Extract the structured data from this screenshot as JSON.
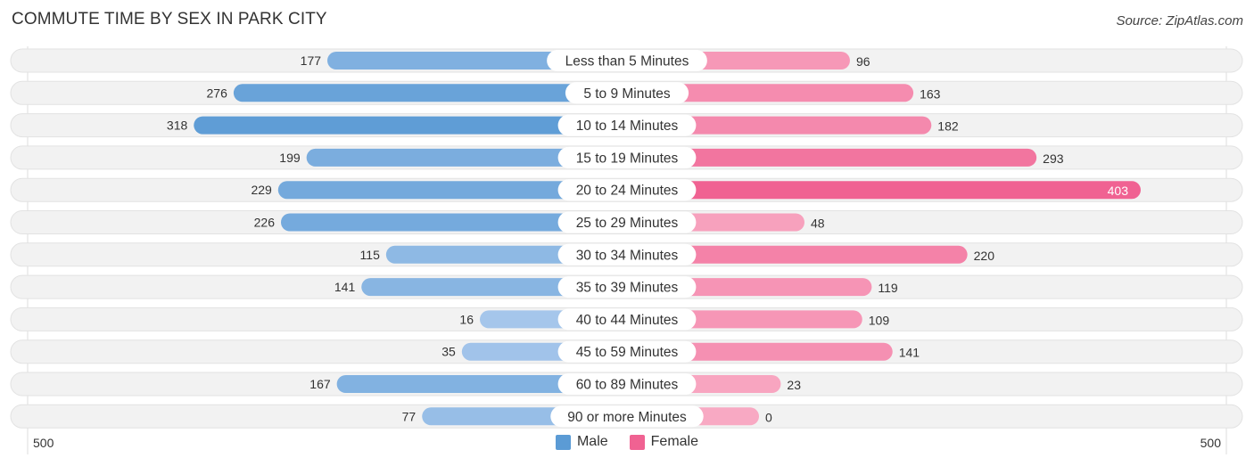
{
  "header": {
    "title": "COMMUTE TIME BY SEX IN PARK CITY",
    "source": "Source: ZipAtlas.com"
  },
  "colors": {
    "male": "#5b9bd5",
    "female": "#f06292",
    "male_light": "#a9c8ec",
    "female_light": "#f8a9c3",
    "track": "#f2f2f2",
    "label_bg": "#ffffff"
  },
  "chart_data": {
    "type": "bar",
    "orientation": "horizontal-diverging",
    "title": "COMMUTE TIME BY SEX IN PARK CITY",
    "categories": [
      "Less than 5 Minutes",
      "5 to 9 Minutes",
      "10 to 14 Minutes",
      "15 to 19 Minutes",
      "20 to 24 Minutes",
      "25 to 29 Minutes",
      "30 to 34 Minutes",
      "35 to 39 Minutes",
      "40 to 44 Minutes",
      "45 to 59 Minutes",
      "60 to 89 Minutes",
      "90 or more Minutes"
    ],
    "series": [
      {
        "name": "Male",
        "side": "left",
        "values": [
          177,
          276,
          318,
          199,
          229,
          226,
          115,
          141,
          16,
          35,
          167,
          77
        ]
      },
      {
        "name": "Female",
        "side": "right",
        "values": [
          96,
          163,
          182,
          293,
          403,
          48,
          220,
          119,
          109,
          141,
          23,
          0
        ]
      }
    ],
    "xlim": [
      0,
      500
    ],
    "axis_labels": {
      "left": "500",
      "right": "500"
    },
    "legend": {
      "position": "bottom-center",
      "entries": [
        "Male",
        "Female"
      ]
    },
    "grid": false
  }
}
